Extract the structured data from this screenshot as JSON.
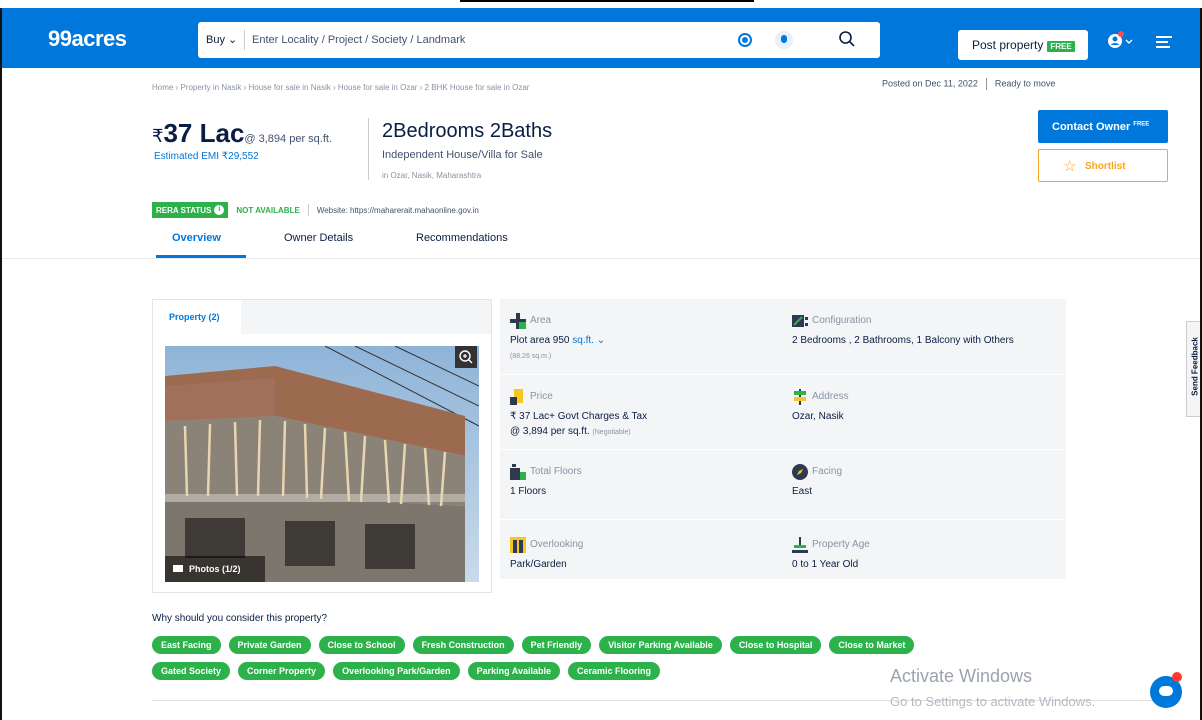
{
  "header": {
    "logo": "99acres",
    "buy_label": "Buy",
    "search_placeholder": "Enter Locality / Project / Society / Landmark",
    "post_property_label": "Post property",
    "free_badge": "FREE"
  },
  "breadcrumb": "Home › Property in Nasik › House for sale in Nasik › House for sale in Ozar › 2 BHK House for sale in Ozar",
  "posted": {
    "date": "Posted on Dec 11, 2022",
    "status": "Ready to move"
  },
  "listing": {
    "price_symbol": "₹",
    "price": "37 Lac",
    "per_sqft": "@ 3,894 per sq.ft.",
    "emi": "Estimated EMI ₹29,552",
    "bhk": "2Bedrooms 2Baths",
    "type": "Independent House/Villa for Sale",
    "locality": "in Ozar, Nasik, Maharashtra"
  },
  "actions": {
    "contact_owner": "Contact Owner",
    "contact_free": "FREE",
    "shortlist": "Shortlist"
  },
  "rera": {
    "badge": "RERA STATUS",
    "info": "i",
    "status": "NOT AVAILABLE",
    "website": "Website: https://maharerait.mahaonline.gov.in"
  },
  "tabs": [
    "Overview",
    "Owner Details",
    "Recommendations"
  ],
  "gallery": {
    "tab_label": "Property (2)",
    "photos_count": "Photos (1/2)"
  },
  "details": [
    {
      "icon": "area-icon",
      "label": "Area",
      "value": "Plot area 950",
      "link": "sq.ft.",
      "sub": "(88.26 sq.m.)"
    },
    {
      "icon": "configuration-icon",
      "label": "Configuration",
      "value": "2 Bedrooms , 2 Bathrooms, 1 Balcony with Others",
      "sub": ""
    },
    {
      "icon": "price-icon",
      "label": "Price",
      "value": "₹ 37 Lac+ Govt Charges & Tax",
      "sub_value": "@ 3,894 per sq.ft.",
      "sub": "(Negotiable)"
    },
    {
      "icon": "address-icon",
      "label": "Address",
      "value": "Ozar, Nasik",
      "sub": ""
    },
    {
      "icon": "floors-icon",
      "label": "Total Floors",
      "value": "1 Floors",
      "sub": ""
    },
    {
      "icon": "facing-icon",
      "label": "Facing",
      "value": "East",
      "sub": ""
    },
    {
      "icon": "overlooking-icon",
      "label": "Overlooking",
      "value": "Park/Garden",
      "sub": ""
    },
    {
      "icon": "property-age-icon",
      "label": "Property Age",
      "value": "0 to 1 Year Old",
      "sub": ""
    }
  ],
  "why": {
    "title": "Why should you consider this property?",
    "chips_row1": [
      "East Facing",
      "Private Garden",
      "Close to School",
      "Fresh Construction",
      "Pet Friendly",
      "Visitor Parking Available",
      "Close to Hospital",
      "Close to Market"
    ],
    "chips_row2": [
      "Gated Society",
      "Corner Property",
      "Overlooking Park/Garden",
      "Parking Available",
      "Ceramic Flooring"
    ]
  },
  "feedback": "Send Feedback",
  "watermark": {
    "title": "Activate Windows",
    "subtitle": "Go to Settings to activate Windows."
  },
  "colors": {
    "brand_blue": "#0078DB",
    "green": "#2DB24B",
    "shortlist_orange": "#F6A623"
  }
}
